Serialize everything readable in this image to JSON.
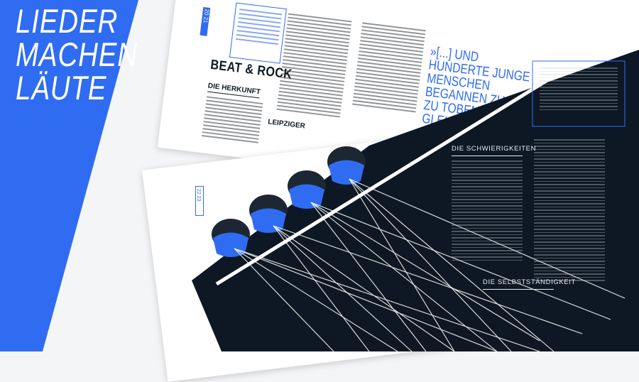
{
  "title": {
    "lines": [
      "LIEDER",
      "MACHEN",
      "LÄUTE"
    ]
  },
  "back_page": {
    "page_numbers": "20 21",
    "heading": "BEAT & ROCK",
    "subheading": "DIE HERKUNFT",
    "subheading_2": "LEIPZIGER",
    "pull_quote": "»[...] UND HUNDERTE JUNGE\nMENSCHEN BEGANNEN ZU\nZU TOBEN IM WAHN\nGLEICHGE TEL"
  },
  "front_page": {
    "page_numbers": "22 23",
    "section_1": "DIE SCHWIERIGKEITEN",
    "section_2": "DIE SELBSTSTÄNDIGKEIT"
  },
  "colors": {
    "accent_blue": "#2f6cf2",
    "dark_navy": "#0d1824",
    "paper": "#ffffff"
  }
}
